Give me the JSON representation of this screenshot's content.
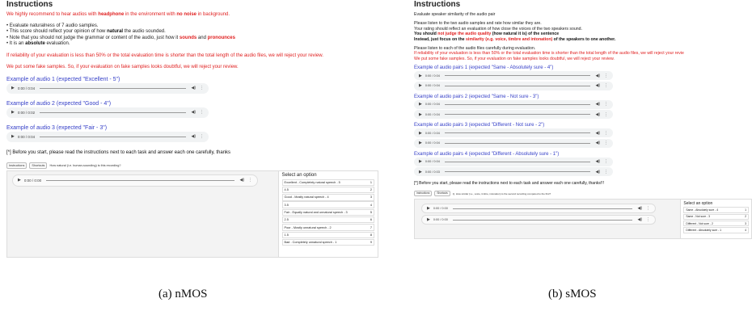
{
  "left": {
    "title": "Instructions",
    "intro": {
      "pre": "We highly recommend to hear audios with ",
      "kw1": "headphone",
      "mid": " in the environment with ",
      "kw2": "no noise",
      "post": " in background."
    },
    "bullets": [
      {
        "text": "• Evaluate naturalness of 7 audio samples."
      },
      {
        "pre": "• This score should reflect your opinion of how ",
        "kw": "natural",
        "post": " the audio sounded."
      },
      {
        "pre": "• Note that you should not judge the grammar or content of the audio, just how it ",
        "kw1": "sounds",
        "mid": " and ",
        "kw2": "pronounces"
      },
      {
        "pre": "• It is an ",
        "kw": "absolute",
        "post": " evaluation."
      }
    ],
    "warning1": "If reliability of your evaluation is less than 50% or the total evaluation time is shorter than the total length of the audio files, we will reject your review.",
    "warning2": "We put some fake samples. So, if your evaluation on fake samples looks doubtful, we will reject your review.",
    "examples": [
      {
        "label": "Example of audio 1 (expected \"Excellent - 5\")",
        "time": "0:00 / 0:04"
      },
      {
        "label": "Example of audio 2 (expected \"Good - 4\")",
        "time": "0:00 / 0:02"
      },
      {
        "label": "Example of audio 3 (expected \"Fair - 3\")",
        "time": "0:00 / 0:04"
      }
    ],
    "footer_note": "[*] Before you start, please read the instructions next to each task and answer each one carefully, thanks",
    "toolbar": {
      "instructions": "Instructions",
      "shortcuts": "Shortcuts",
      "question": "How natural (i.e. human-sounding) is this recording?"
    },
    "task_time": "0:00 / 0:00",
    "select_title": "Select an option",
    "options": [
      {
        "label": "Excellent - Completely natural speech - 5",
        "key": "1"
      },
      {
        "label": "4.5",
        "key": "2"
      },
      {
        "label": "Good - Mostly natural speech - 4",
        "key": "3"
      },
      {
        "label": "3.5",
        "key": "4"
      },
      {
        "label": "Fair - Equally natural and unnatural speech - 3",
        "key": "5"
      },
      {
        "label": "2.5",
        "key": "6"
      },
      {
        "label": "Poor - Mostly unnatural speech - 2",
        "key": "7"
      },
      {
        "label": "1.5",
        "key": "8"
      },
      {
        "label": "Bad - Completely unnatural speech - 1",
        "key": "9"
      }
    ],
    "caption": "(a) nMOS"
  },
  "right": {
    "title": "Instructions",
    "subtitle": "Evaluate speaker similarity of the audio pair",
    "lines": [
      "Please listen to the two audio samples and rate how similar they are.",
      "Your rating should reflect an evaluation of how close the voices of the two speakers sound."
    ],
    "line_bold1": {
      "pre": "You should ",
      "kw": "not judge the audio quality",
      "post": " (how natural it is) of the sentence"
    },
    "line_bold2": {
      "pre": "Instead, just focus on the ",
      "kw": "similarity (e.g. voice, timbre and intonation)",
      "post": " of the speakers to one another."
    },
    "line_listen": "Please listen to each of the audio files carefully during evaluation.",
    "warning1": "If reliability of your evaluation is less than 50% or the total evaluation time is shorter than the total length of the audio files, we will reject your revie",
    "warning2": "We put some fake samples. So, if your evaluation on fake samples looks doubtful, we will reject your review.",
    "examples": [
      {
        "label": "Example of audio pairs 1 (expected \"Same - Absolutely sure - 4\")",
        "time1": "0:00 / 0:04",
        "time2": "0:00 / 0:04"
      },
      {
        "label": "Example of audio pairs 2 (expected \"Same - Not sure - 3\")",
        "time1": "0:00 / 0:04",
        "time2": "0:00 / 0:04"
      },
      {
        "label": "Example of audio pairs 3 (expected \"Different - Not sure - 2\")",
        "time1": "0:00 / 0:04",
        "time2": "0:00 / 0:04"
      },
      {
        "label": "Example of audio pairs 4 (expected \"Different - Absolutely sure - 1\")",
        "time1": "0:00 / 0:04",
        "time2": "0:00 / 0:03"
      }
    ],
    "footer_note": "[*] Before you start, please read the instructions next to each task and answer each one carefully, thanks!!!",
    "toolbar": {
      "instructions": "Instructions",
      "shortcuts": "Shortcuts",
      "question": "Q. How similar (i.e., voice, timbre, intonation) is the second recording compared to the first?"
    },
    "task_time1": "0:00 / 0:00",
    "task_time2": "0:00 / 0:00",
    "select_title": "Select an option",
    "options": [
      {
        "label": "Same - Absolutely sure - 4",
        "key": "1"
      },
      {
        "label": "Same - Not sure - 3",
        "key": "2"
      },
      {
        "label": "Different - Not sure - 2",
        "key": "3"
      },
      {
        "label": "Different - Absolutely sure - 1",
        "key": "4"
      }
    ],
    "caption": "(b) sMOS"
  }
}
